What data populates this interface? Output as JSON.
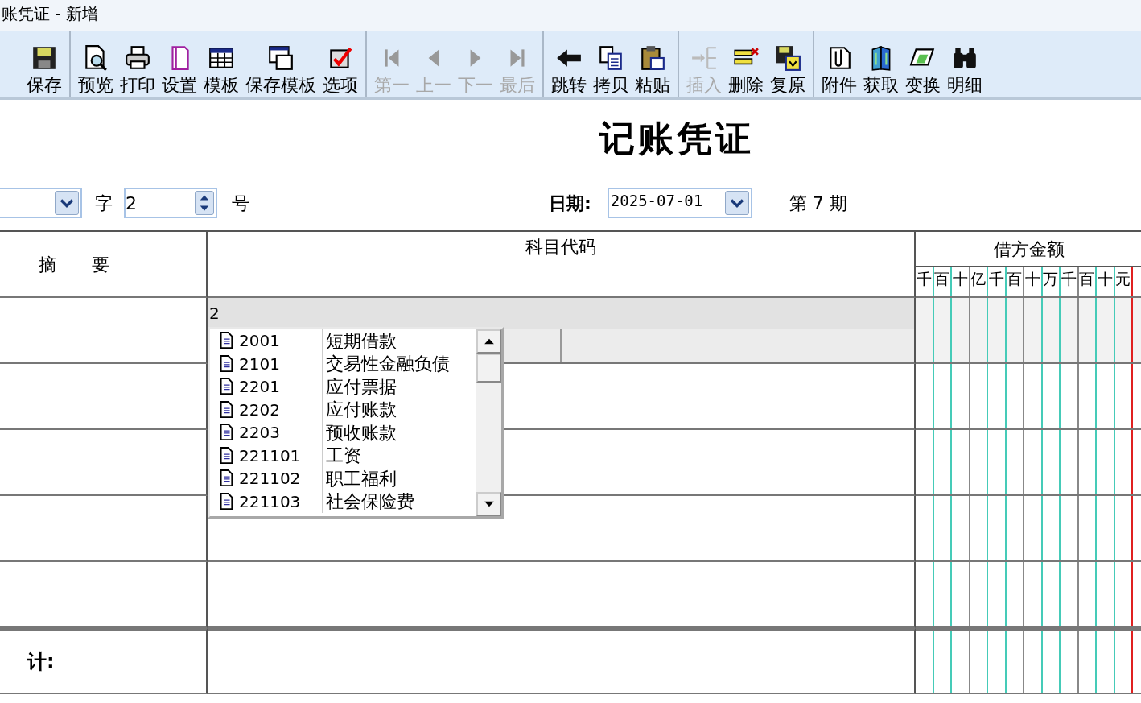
{
  "window": {
    "title": "账凭证 - 新增"
  },
  "toolbar": {
    "groups": [
      [
        {
          "label": "保存",
          "disabled": false
        }
      ],
      [
        {
          "label": "预览",
          "disabled": false
        },
        {
          "label": "打印",
          "disabled": false
        },
        {
          "label": "设置",
          "disabled": false
        },
        {
          "label": "模板",
          "disabled": false
        },
        {
          "label": "保存模板",
          "disabled": false
        },
        {
          "label": "选项",
          "disabled": false
        }
      ],
      [
        {
          "label": "第一",
          "disabled": true
        },
        {
          "label": "上一",
          "disabled": true
        },
        {
          "label": "下一",
          "disabled": true
        },
        {
          "label": "最后",
          "disabled": true
        }
      ],
      [
        {
          "label": "跳转",
          "disabled": false
        },
        {
          "label": "拷贝",
          "disabled": false
        },
        {
          "label": "粘贴",
          "disabled": false
        }
      ],
      [
        {
          "label": "插入",
          "disabled": true
        },
        {
          "label": "删除",
          "disabled": false
        },
        {
          "label": "复原",
          "disabled": false
        }
      ],
      [
        {
          "label": "附件",
          "disabled": false
        },
        {
          "label": "获取",
          "disabled": false
        },
        {
          "label": "变换",
          "disabled": false
        },
        {
          "label": "明细",
          "disabled": false
        }
      ]
    ]
  },
  "voucher": {
    "title": "记账凭证",
    "word_label": "字",
    "number": "2",
    "number_label": "号",
    "date_label": "日期:",
    "date": "2025-07-01",
    "period": "第 7 期"
  },
  "table": {
    "columns": [
      {
        "label": "摘　　要"
      },
      {
        "label": "科目代码"
      },
      {
        "label": "借方金额"
      }
    ],
    "digit_headers": [
      "千",
      "百",
      "十",
      "亿",
      "千",
      "百",
      "十",
      "万",
      "千",
      "百",
      "十",
      "元"
    ],
    "editing_value": "2",
    "total_label": "计:"
  },
  "dropdown": {
    "items": [
      {
        "code": "2001",
        "name": "短期借款"
      },
      {
        "code": "2101",
        "name": "交易性金融负债"
      },
      {
        "code": "2201",
        "name": "应付票据"
      },
      {
        "code": "2202",
        "name": "应付账款"
      },
      {
        "code": "2203",
        "name": "预收账款"
      },
      {
        "code": "221101",
        "name": "工资"
      },
      {
        "code": "221102",
        "name": "职工福利"
      },
      {
        "code": "221103",
        "name": "社会保险费"
      }
    ]
  }
}
